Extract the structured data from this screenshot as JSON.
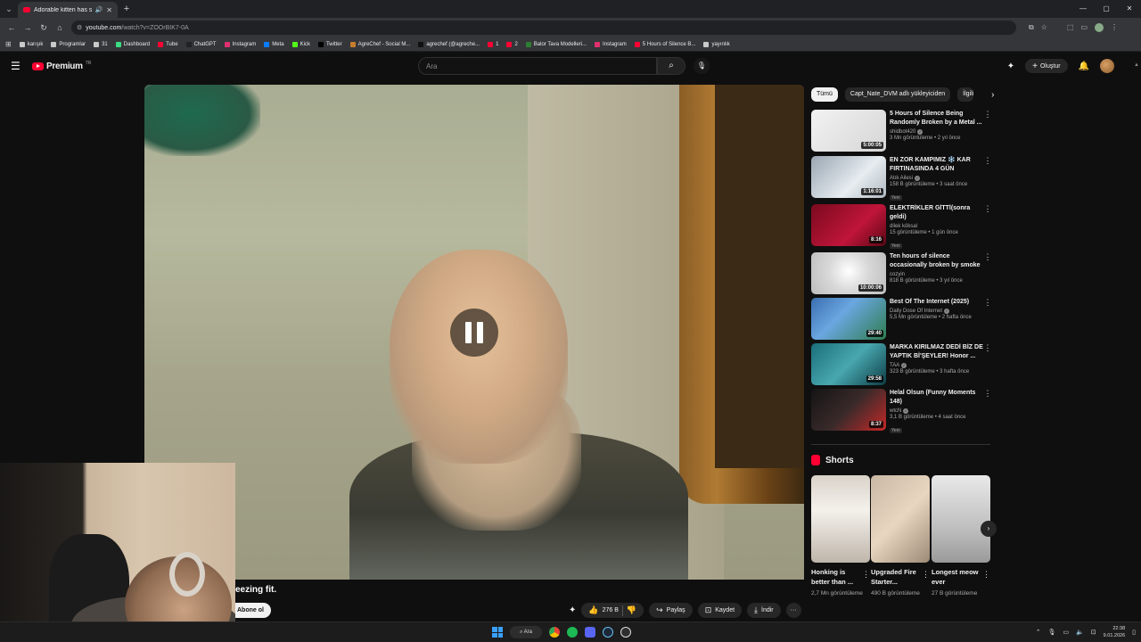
{
  "browser": {
    "tab_title": "Adorable kitten has sneezin",
    "url_host": "youtube.com",
    "url_path": "/watch?v=ZOOrBIK7-0A",
    "bookmarks": [
      {
        "label": "karışık",
        "icon": "folder-icon",
        "color": "#c9c9c9"
      },
      {
        "label": "Programlar",
        "icon": "folder-icon",
        "color": "#c9c9c9"
      },
      {
        "label": "31",
        "icon": "folder-icon",
        "color": "#c9c9c9"
      },
      {
        "label": "Dashboard",
        "icon": "dashboard-icon",
        "color": "#3ddc84"
      },
      {
        "label": "Tube",
        "icon": "youtube-icon",
        "color": "#ff0033"
      },
      {
        "label": "ChatGPT",
        "icon": "chatgpt-icon",
        "color": "#222222"
      },
      {
        "label": "Instagram",
        "icon": "instagram-icon",
        "color": "#e1306c"
      },
      {
        "label": "Meta",
        "icon": "meta-icon",
        "color": "#0a7cff"
      },
      {
        "label": "Kick",
        "icon": "kick-icon",
        "color": "#53fc18"
      },
      {
        "label": "Twitter",
        "icon": "x-icon",
        "color": "#000000"
      },
      {
        "label": "AgreChef - Social M...",
        "icon": "agrechef-icon",
        "color": "#c77d2c"
      },
      {
        "label": "agrechef (@agreche...",
        "icon": "tiktok-icon",
        "color": "#111111"
      },
      {
        "label": "1",
        "icon": "youtube-icon",
        "color": "#ff0033"
      },
      {
        "label": "2",
        "icon": "youtube-icon",
        "color": "#ff0033"
      },
      {
        "label": "Balor Tava Modelleri...",
        "icon": "site-icon",
        "color": "#2e7d32"
      },
      {
        "label": "Instagram",
        "icon": "instagram-icon",
        "color": "#e1306c"
      },
      {
        "label": "5 Hours of Silence B...",
        "icon": "youtube-icon",
        "color": "#ff0033"
      },
      {
        "label": "yayınlık",
        "icon": "folder-icon",
        "color": "#c9c9c9"
      }
    ]
  },
  "masthead": {
    "logo_text": "Premium",
    "logo_sup": "TR",
    "search_placeholder": "Ara",
    "create_label": "Oluştur"
  },
  "video": {
    "title_partial": "eezing fit.",
    "subscribe_label": "Abone ol",
    "like_count": "276 B",
    "share_label": "Paylaş",
    "save_label": "Kaydet",
    "download_label": "İndir",
    "more_label": "···",
    "state": "paused-overlay"
  },
  "sidebar": {
    "chips": [
      "Tümü",
      "Capt_Nate_DVM adlı yükleyiciden",
      "İlgili"
    ],
    "recommendations": [
      {
        "title": "5 Hours of Silence Being Randomly Broken by a Metal ...",
        "channel": "shidbot420",
        "verified": true,
        "views": "3 Mn görüntüleme • 2 yıl önce",
        "badge": "",
        "duration": "5:00:05",
        "thumb": "linear-gradient(135deg,#f2f2f2,#d6d6d6)"
      },
      {
        "title": "EN ZOR KAMPIMIZ ❄️ KAR FIRTINASINDA 4 GÜN",
        "channel": "Atık Ailesi",
        "verified": true,
        "views": "158 B görüntüleme • 3 saat önce",
        "badge": "Yeni",
        "duration": "1:16:01",
        "thumb": "linear-gradient(135deg,#9aa6b2,#e6ecf0 60%,#b0b8c0)"
      },
      {
        "title": "ELEKTRİKLER GİTTİ(sonra geldi)",
        "channel": "dilek köksal",
        "verified": false,
        "views": "15 görüntüleme • 1 gün önce",
        "badge": "Yeni",
        "duration": "8:16",
        "thumb": "linear-gradient(135deg,#7a0a1e,#c0153a 60%,#5a0714)"
      },
      {
        "title": "Ten hours of silence occasionally broken by smoke ...",
        "channel": "cozyin",
        "verified": false,
        "views": "818 B görüntüleme • 3 yıl önce",
        "badge": "",
        "duration": "10:00:06",
        "thumb": "radial-gradient(circle at 50% 45%,#ffffff,#d9d9d9 45%,#bdbdbd)"
      },
      {
        "title": "Best Of The Internet (2025)",
        "channel": "Daily Dose Of Internet",
        "verified": true,
        "views": "5,5 Mn görüntüleme • 2 hafta önce",
        "badge": "",
        "duration": "29:40",
        "thumb": "linear-gradient(135deg,#3b6fb0,#6aa6e0 40%,#2e7d4f)"
      },
      {
        "title": "MARKA KIRILMAZ DEDİ BİZ DE YAPTIK Bİ'ŞEYLER!  Honor ...",
        "channel": "TAA",
        "verified": true,
        "views": "323 B görüntüleme • 3 hafta önce",
        "badge": "",
        "duration": "29:58",
        "thumb": "linear-gradient(135deg,#1a6e78,#48a7b0 50%,#0d3e45)"
      },
      {
        "title": "Helal Olsun (Funny Moments 148)",
        "channel": "wtcN",
        "verified": true,
        "views": "3,1 B görüntüleme • 4 saat önce",
        "badge": "Yeni",
        "duration": "8:37",
        "thumb": "linear-gradient(135deg,#141414,#3a2a2a 50%,#c62828)"
      }
    ],
    "shorts_heading": "Shorts",
    "shorts": [
      {
        "title": "Honking is better than ...",
        "views": "2,7 Mn görüntüleme",
        "thumb": "linear-gradient(180deg,#d9d2c8,#f4f1ec 40%,#bfb6aa)"
      },
      {
        "title": "Upgraded Fire Starter...",
        "views": "490 B görüntüleme",
        "thumb": "linear-gradient(135deg,#c9b8a4,#e8d6c0 50%,#9c8a76)"
      },
      {
        "title": "Longest meow ever",
        "views": "27 B görüntüleme",
        "thumb": "linear-gradient(180deg,#e9e9e9,#bfbfbf 60%,#9a9a9a)"
      }
    ]
  },
  "taskbar": {
    "search_label": "Ara",
    "time": "22:38",
    "date": "9.01.2026"
  },
  "colors": {
    "youtube_red": "#ff0033",
    "background": "#0f0f0f",
    "windows_accent": "#3aa0ff"
  }
}
